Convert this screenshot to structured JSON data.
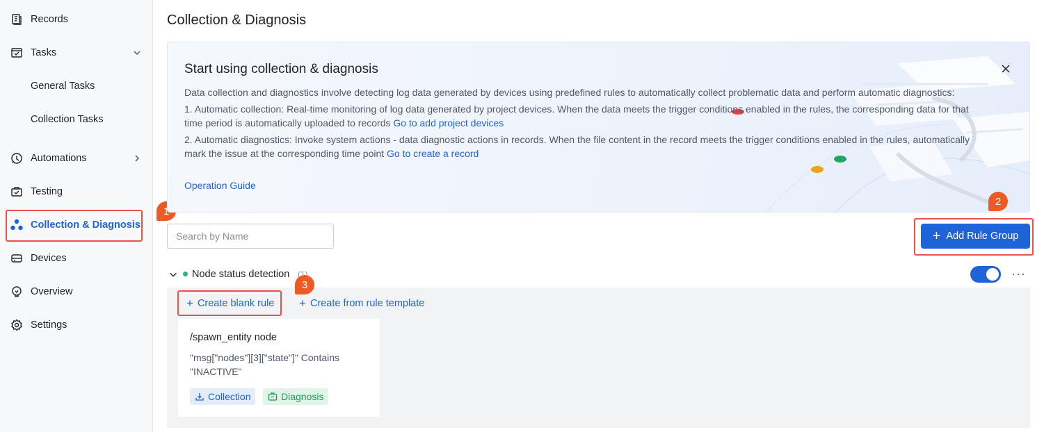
{
  "sidebar": {
    "items": [
      {
        "label": "Records",
        "icon": "records-icon"
      },
      {
        "label": "Tasks",
        "icon": "tasks-icon"
      },
      {
        "label": "General Tasks"
      },
      {
        "label": "Collection Tasks"
      },
      {
        "label": "Automations",
        "icon": "automations-icon"
      },
      {
        "label": "Testing",
        "icon": "testing-icon"
      },
      {
        "label": "Collection & Diagnosis",
        "icon": "collection-diagnosis-icon",
        "active": true
      },
      {
        "label": "Devices",
        "icon": "devices-icon"
      },
      {
        "label": "Overview",
        "icon": "overview-icon"
      },
      {
        "label": "Settings",
        "icon": "settings-icon"
      }
    ]
  },
  "page": {
    "title": "Collection & Diagnosis"
  },
  "banner": {
    "title": "Start using collection & diagnosis",
    "intro": "Data collection and diagnostics involve detecting log data generated by devices using predefined rules to automatically collect problematic data and perform automatic diagnostics:",
    "point1_a": "1. Automatic collection: Real-time monitoring of log data generated by project devices. When the data meets the trigger conditions enabled in the rules, the corresponding data for that",
    "point1_b": "time period is automatically uploaded to records ",
    "point1_link": "Go to add project devices",
    "point2_a": "2. Automatic diagnostics: Invoke system actions - data diagnostic actions in records. When the file content in the record meets the trigger conditions enabled in the rules, automatically",
    "point2_b": "mark the issue at the corresponding time point ",
    "point2_link": "Go to create a record",
    "guide_link": "Operation Guide"
  },
  "search": {
    "placeholder": "Search by Name",
    "value": ""
  },
  "toolbar": {
    "add_rule_group": "Add Rule Group"
  },
  "badges": {
    "b1": "1",
    "b2": "2",
    "b3": "3"
  },
  "group": {
    "name": "Node status detection",
    "count": "(1)",
    "enabled": true,
    "more": "···",
    "create_blank": "Create blank rule",
    "create_template": "Create from rule template",
    "rules": [
      {
        "title": "/spawn_entity node",
        "condition": "\"msg[\"nodes\"][3][\"state\"]\" Contains \"INACTIVE\"",
        "tag_collection": "Collection",
        "tag_diagnosis": "Diagnosis"
      }
    ]
  },
  "colors": {
    "accent": "#1e63d8",
    "highlight": "#e8534a",
    "badge": "#ee5a24",
    "status_dot": "#2bb673"
  }
}
